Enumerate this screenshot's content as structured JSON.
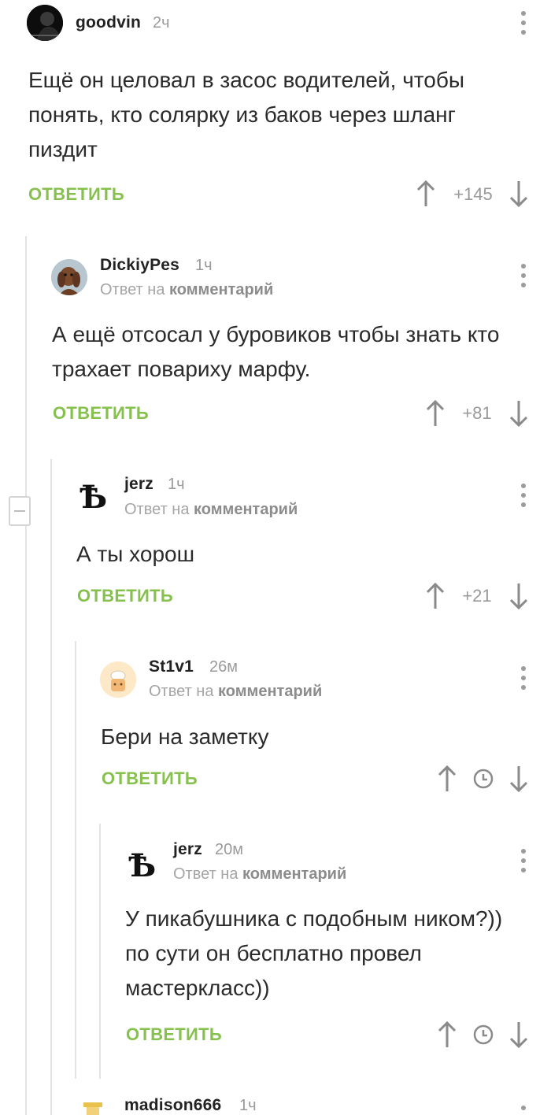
{
  "comments": [
    {
      "author": "goodvin",
      "time": "2ч",
      "text": "Ещё он целовал в засос водителей, чтобы понять, кто солярку из баков через шланг пиздит",
      "reply_label": "ОТВЕТИТЬ",
      "score": "+145"
    },
    {
      "author": "DickiyPes",
      "time": "1ч",
      "reply_to_prefix": "Ответ на",
      "reply_to_link": "комментарий",
      "text": "А ещё отсосал у буровиков чтобы знать кто трахает повариху марфу.",
      "reply_label": "ОТВЕТИТЬ",
      "score": "+81"
    },
    {
      "author": "jerz",
      "time": "1ч",
      "reply_to_prefix": "Ответ на",
      "reply_to_link": "комментарий",
      "text": "А ты хорош",
      "reply_label": "ОТВЕТИТЬ",
      "score": "+21",
      "avatar_glyph": "Ѣ"
    },
    {
      "author": "St1v1",
      "time": "26м",
      "reply_to_prefix": "Ответ на",
      "reply_to_link": "комментарий",
      "text": "Бери на заметку",
      "reply_label": "ОТВЕТИТЬ"
    },
    {
      "author": "jerz",
      "time": "20м",
      "reply_to_prefix": "Ответ на",
      "reply_to_link": "комментарий",
      "text": "У пикабушника с подобным ником?)) по сути он бесплатно провел мастеркласс))",
      "reply_label": "ОТВЕТИТЬ",
      "avatar_glyph": "Ѣ"
    },
    {
      "author": "madison666",
      "time": "1ч"
    }
  ],
  "colors": {
    "reply_green": "#86c14e",
    "muted_gray": "#9a9a9a",
    "thread_line": "#e3e3e3"
  },
  "icons": [
    "vertical-dots-icon",
    "arrow-up-icon",
    "arrow-down-icon",
    "clock-icon",
    "collapse-minus-icon"
  ]
}
